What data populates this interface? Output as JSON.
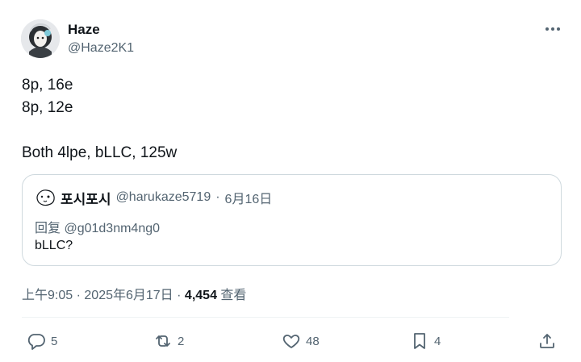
{
  "author": {
    "display_name": "Haze",
    "handle": "@Haze2K1"
  },
  "tweet": {
    "lines": [
      "8p, 16e",
      "8p, 12e",
      "",
      "Both 4lpe, bLLC, 125w"
    ]
  },
  "quoted": {
    "display_name": "포시포시",
    "handle": "@harukaze5719",
    "separator": "·",
    "date": "6月16日",
    "reply_prefix": "回复",
    "reply_handle": "@g01d3nm4ng0",
    "body": "bLLC?"
  },
  "meta": {
    "time": "上午9:05",
    "sep1": "·",
    "date": "2025年6月17日",
    "sep2": "·",
    "views_count": "4,454",
    "views_label": "查看"
  },
  "actions": {
    "reply_count": "5",
    "retweet_count": "2",
    "like_count": "48",
    "bookmark_count": "4"
  },
  "icons": {
    "more": "more-horizontal-icon",
    "reply": "reply-icon",
    "retweet": "retweet-icon",
    "like": "heart-icon",
    "bookmark": "bookmark-icon",
    "share": "share-icon"
  },
  "colors": {
    "text_primary": "#0f1419",
    "text_secondary": "#536471",
    "border": "#cfd9de"
  }
}
